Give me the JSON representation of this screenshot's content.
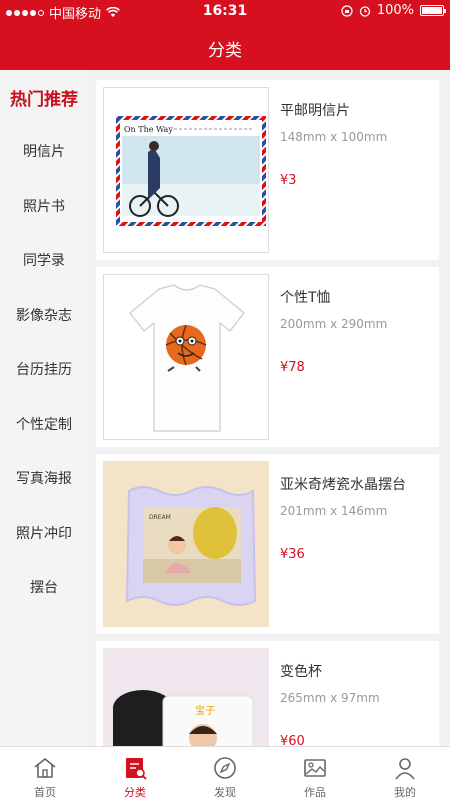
{
  "status": {
    "carrier": "中国移动",
    "time": "16:31",
    "battery": "100%"
  },
  "header": {
    "title": "分类"
  },
  "sidebar": {
    "items": [
      {
        "label": "热门推荐",
        "active": true
      },
      {
        "label": "明信片"
      },
      {
        "label": "照片书"
      },
      {
        "label": "同学录"
      },
      {
        "label": "影像杂志"
      },
      {
        "label": "台历挂历"
      },
      {
        "label": "个性定制"
      },
      {
        "label": "写真海报"
      },
      {
        "label": "照片冲印"
      },
      {
        "label": "摆台"
      }
    ]
  },
  "products": [
    {
      "name": "平邮明信片",
      "size": "148mm x 100mm",
      "price": "¥3",
      "image_text": "On The Way"
    },
    {
      "name": "个性T恤",
      "size": "200mm x 290mm",
      "price": "¥78"
    },
    {
      "name": "亚米奇烤瓷水晶摆台",
      "size": "201mm x 146mm",
      "price": "¥36",
      "image_text": "DREAM"
    },
    {
      "name": "变色杯",
      "size": "265mm x 97mm",
      "price": "¥60",
      "image_text": "宝子"
    }
  ],
  "tabbar": {
    "items": [
      {
        "label": "首页",
        "icon": "home-icon"
      },
      {
        "label": "分类",
        "icon": "category-icon",
        "active": true
      },
      {
        "label": "发现",
        "icon": "compass-icon"
      },
      {
        "label": "作品",
        "icon": "picture-icon"
      },
      {
        "label": "我的",
        "icon": "user-icon"
      }
    ]
  },
  "colors": {
    "brand": "#d6101e",
    "sidebar_bg": "#f4f4f4",
    "content_bg": "#f2f2f2"
  }
}
